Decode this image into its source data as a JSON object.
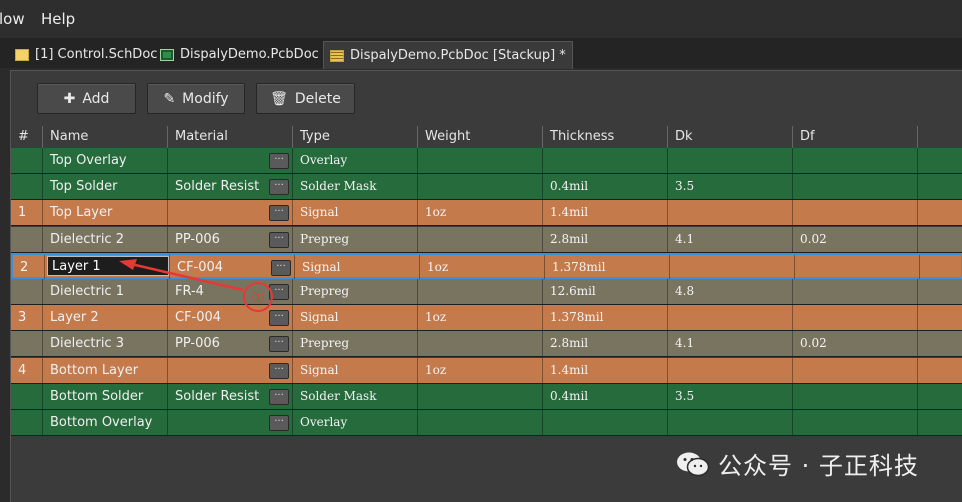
{
  "menu": {
    "items": [
      "low",
      "Help"
    ]
  },
  "tabs": [
    {
      "label": "[1] Control.SchDoc",
      "icon": "schematic-icon"
    },
    {
      "label": "DispalyDemo.PcbDoc *",
      "icon": "pcb-icon"
    },
    {
      "label": "DispalyDemo.PcbDoc [Stackup] *",
      "icon": "stackup-icon",
      "active": true
    }
  ],
  "toolbar": {
    "add_label": "Add",
    "modify_label": "Modify",
    "delete_label": "Delete"
  },
  "table": {
    "columns": [
      "#",
      "Name",
      "Material",
      "Type",
      "Weight",
      "Thickness",
      "Dk",
      "Df"
    ],
    "rows": [
      {
        "num": "",
        "name": "Top Overlay",
        "material": "",
        "type": "Overlay",
        "weight": "",
        "thickness": "",
        "dk": "",
        "df": "",
        "color": "green"
      },
      {
        "num": "",
        "name": "Top Solder",
        "material": "Solder Resist",
        "type": "Solder Mask",
        "weight": "",
        "thickness": "0.4mil",
        "dk": "3.5",
        "df": "",
        "color": "green"
      },
      {
        "num": "1",
        "name": "Top Layer",
        "material": "",
        "type": "Signal",
        "weight": "1oz",
        "thickness": "1.4mil",
        "dk": "",
        "df": "",
        "color": "orange"
      },
      {
        "num": "",
        "name": "Dielectric 2",
        "material": "PP-006",
        "type": "Prepreg",
        "weight": "",
        "thickness": "2.8mil",
        "dk": "4.1",
        "df": "0.02",
        "color": "grey"
      },
      {
        "num": "2",
        "name": "Layer 1",
        "material": "CF-004",
        "type": "Signal",
        "weight": "1oz",
        "thickness": "1.378mil",
        "dk": "",
        "df": "",
        "color": "orange",
        "selected": true
      },
      {
        "num": "",
        "name": "Dielectric 1",
        "material": "FR-4",
        "type": "Prepreg",
        "weight": "",
        "thickness": "12.6mil",
        "dk": "4.8",
        "df": "",
        "color": "grey"
      },
      {
        "num": "3",
        "name": "Layer 2",
        "material": "CF-004",
        "type": "Signal",
        "weight": "1oz",
        "thickness": "1.378mil",
        "dk": "",
        "df": "",
        "color": "orange"
      },
      {
        "num": "",
        "name": "Dielectric 3",
        "material": "PP-006",
        "type": "Prepreg",
        "weight": "",
        "thickness": "2.8mil",
        "dk": "4.1",
        "df": "0.02",
        "color": "grey"
      },
      {
        "num": "4",
        "name": "Bottom Layer",
        "material": "",
        "type": "Signal",
        "weight": "1oz",
        "thickness": "1.4mil",
        "dk": "",
        "df": "",
        "color": "orange"
      },
      {
        "num": "",
        "name": "Bottom Solder",
        "material": "Solder Resist",
        "type": "Solder Mask",
        "weight": "",
        "thickness": "0.4mil",
        "dk": "3.5",
        "df": "",
        "color": "green"
      },
      {
        "num": "",
        "name": "Bottom Overlay",
        "material": "",
        "type": "Overlay",
        "weight": "",
        "thickness": "",
        "dk": "",
        "df": "",
        "color": "green"
      }
    ]
  },
  "annotation": {
    "marker": "①",
    "color": "#e53935"
  },
  "watermark": {
    "text": "公众号 · 子正科技",
    "icon": "wechat-icon"
  },
  "colors": {
    "green": "#256b3c",
    "orange": "#c47a4b",
    "grey": "#787460",
    "selection": "#3d8fd6"
  }
}
